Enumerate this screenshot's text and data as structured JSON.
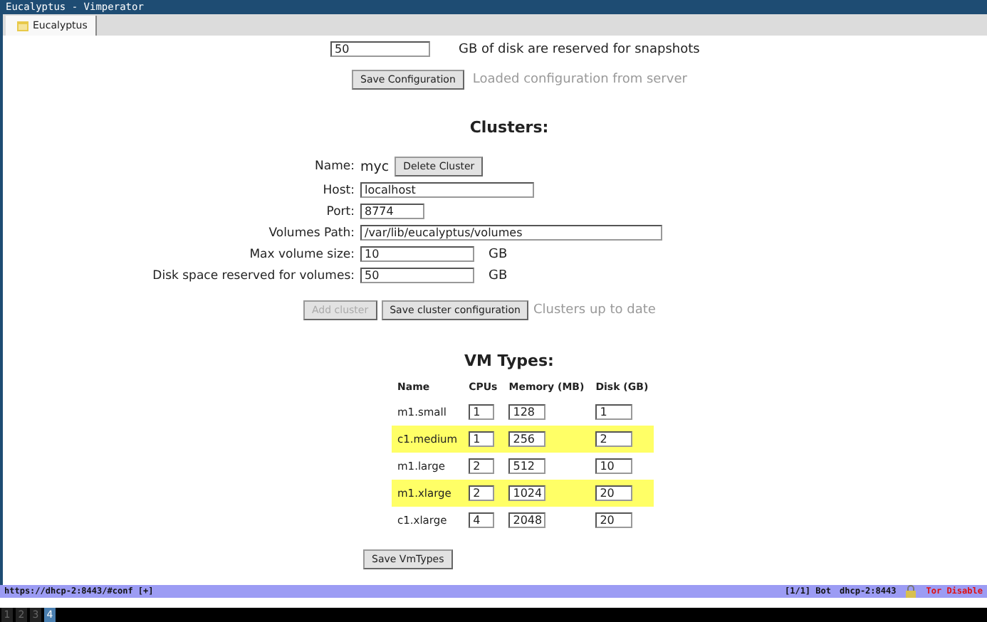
{
  "window": {
    "title": "Eucalyptus - Vimperator"
  },
  "tabs": [
    {
      "label": "Eucalyptus",
      "selected": true
    }
  ],
  "snapshots": {
    "value": "50",
    "label": "GB of disk are reserved for snapshots"
  },
  "save_configuration": {
    "button": "Save Configuration",
    "status": "Loaded configuration from server"
  },
  "clusters": {
    "heading": "Clusters:",
    "name_label": "Name:",
    "name": "myc",
    "delete_button": "Delete Cluster",
    "fields": [
      {
        "label": "Host:",
        "value": "localhost",
        "kind": "medium"
      },
      {
        "label": "Port:",
        "value": "8774",
        "kind": "small"
      },
      {
        "label": "Volumes Path:",
        "value": "/var/lib/eucalyptus/volumes",
        "kind": "large"
      },
      {
        "label": "Max volume size:",
        "value": "10",
        "kind": "unit",
        "unit": "GB"
      },
      {
        "label": "Disk space reserved for volumes:",
        "value": "50",
        "kind": "unit",
        "unit": "GB"
      }
    ],
    "add_button": {
      "label": "Add cluster",
      "disabled": true
    },
    "save_button": "Save cluster configuration",
    "status": "Clusters up to date"
  },
  "vm_types": {
    "heading": "VM Types:",
    "columns": [
      "Name",
      "CPUs",
      "Memory (MB)",
      "Disk (GB)"
    ],
    "rows": [
      {
        "name": "m1.small",
        "cpus": "1",
        "memory": "128",
        "disk": "1",
        "highlighted": false
      },
      {
        "name": "c1.medium",
        "cpus": "1",
        "memory": "256",
        "disk": "2",
        "highlighted": true
      },
      {
        "name": "m1.large",
        "cpus": "2",
        "memory": "512",
        "disk": "10",
        "highlighted": false
      },
      {
        "name": "m1.xlarge",
        "cpus": "2",
        "memory": "1024",
        "disk": "20",
        "highlighted": true
      },
      {
        "name": "c1.xlarge",
        "cpus": "4",
        "memory": "2048",
        "disk": "20",
        "highlighted": false
      }
    ],
    "save_button": "Save VmTypes"
  },
  "status_bar": {
    "url": "https://dhcp-2:8443/#conf [+]",
    "position": "[1/1] Bot",
    "host": "dhcp-2:8443",
    "tor": "Tor Disable"
  },
  "workspaces": [
    {
      "label": "1",
      "selected": false
    },
    {
      "label": "2",
      "selected": false
    },
    {
      "label": "3",
      "selected": false
    },
    {
      "label": "4",
      "selected": true
    }
  ]
}
